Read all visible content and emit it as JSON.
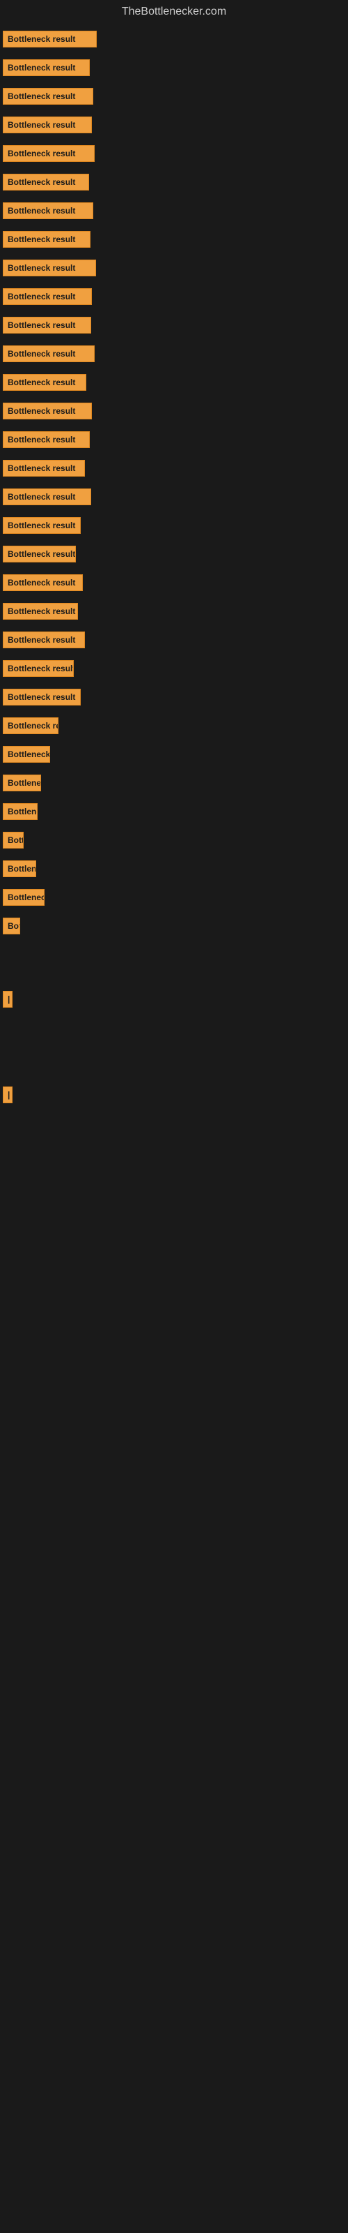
{
  "site_title": "TheBottlenecker.com",
  "bars": [
    {
      "label": "Bottleneck result",
      "width": 135
    },
    {
      "label": "Bottleneck result",
      "width": 125
    },
    {
      "label": "Bottleneck result",
      "width": 130
    },
    {
      "label": "Bottleneck result",
      "width": 128
    },
    {
      "label": "Bottleneck result",
      "width": 132
    },
    {
      "label": "Bottleneck result",
      "width": 124
    },
    {
      "label": "Bottleneck result",
      "width": 130
    },
    {
      "label": "Bottleneck result",
      "width": 126
    },
    {
      "label": "Bottleneck result",
      "width": 134
    },
    {
      "label": "Bottleneck result",
      "width": 128
    },
    {
      "label": "Bottleneck result",
      "width": 127
    },
    {
      "label": "Bottleneck result",
      "width": 132
    },
    {
      "label": "Bottleneck result",
      "width": 120
    },
    {
      "label": "Bottleneck result",
      "width": 128
    },
    {
      "label": "Bottleneck result",
      "width": 125
    },
    {
      "label": "Bottleneck result",
      "width": 118
    },
    {
      "label": "Bottleneck result",
      "width": 127
    },
    {
      "label": "Bottleneck result",
      "width": 112
    },
    {
      "label": "Bottleneck result",
      "width": 105
    },
    {
      "label": "Bottleneck result",
      "width": 115
    },
    {
      "label": "Bottleneck result",
      "width": 108
    },
    {
      "label": "Bottleneck result",
      "width": 118
    },
    {
      "label": "Bottleneck result",
      "width": 102
    },
    {
      "label": "Bottleneck result",
      "width": 112
    },
    {
      "label": "Bottleneck result",
      "width": 80
    },
    {
      "label": "Bottleneck result",
      "width": 68
    },
    {
      "label": "Bottleneck result",
      "width": 55
    },
    {
      "label": "Bottleneck result",
      "width": 50
    },
    {
      "label": "Bottleneck result",
      "width": 30
    },
    {
      "label": "Bottleneck result",
      "width": 48
    },
    {
      "label": "Bottleneck result",
      "width": 60
    },
    {
      "label": "Bottleneck result",
      "width": 25
    },
    {
      "label": "",
      "width": 0
    },
    {
      "label": "",
      "width": 0
    },
    {
      "label": "|",
      "width": 12
    },
    {
      "label": "",
      "width": 0
    },
    {
      "label": "",
      "width": 0
    },
    {
      "label": "",
      "width": 0
    },
    {
      "label": "|",
      "width": 12
    }
  ]
}
